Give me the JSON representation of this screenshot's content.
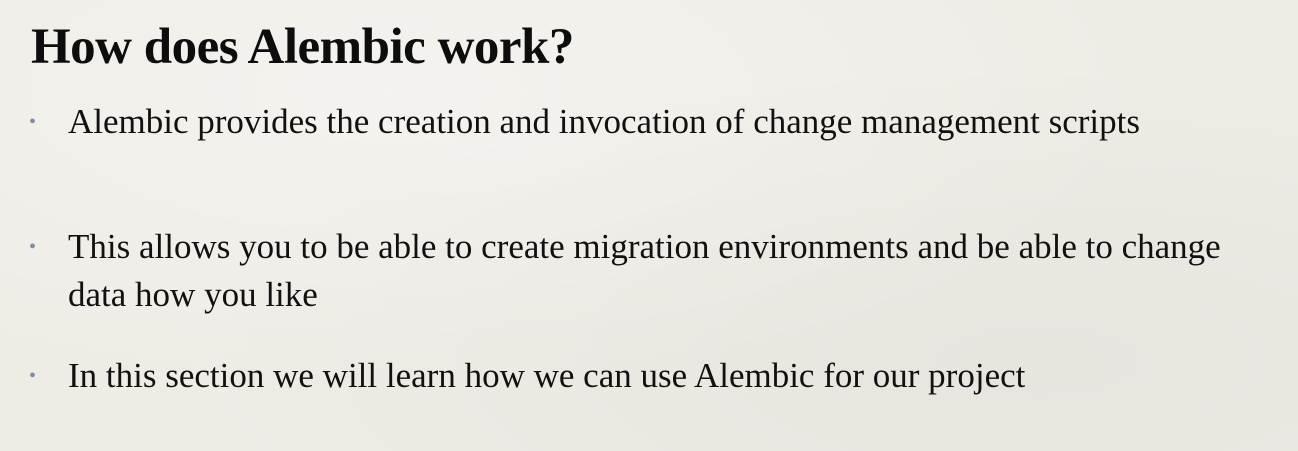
{
  "slide": {
    "title": "How does Alembic work?",
    "bullets": [
      {
        "marker": "•",
        "text": "Alembic provides the creation and invocation of change management scripts"
      },
      {
        "marker": "•",
        "text": "This allows you to be able to create migration environments and be able to change data how you like"
      },
      {
        "marker": "•",
        "text": "In this section we will learn how we can use Alembic for our project"
      }
    ]
  },
  "colors": {
    "background": "#efece6",
    "text": "#111111",
    "bullet": "#7a8fa8"
  }
}
